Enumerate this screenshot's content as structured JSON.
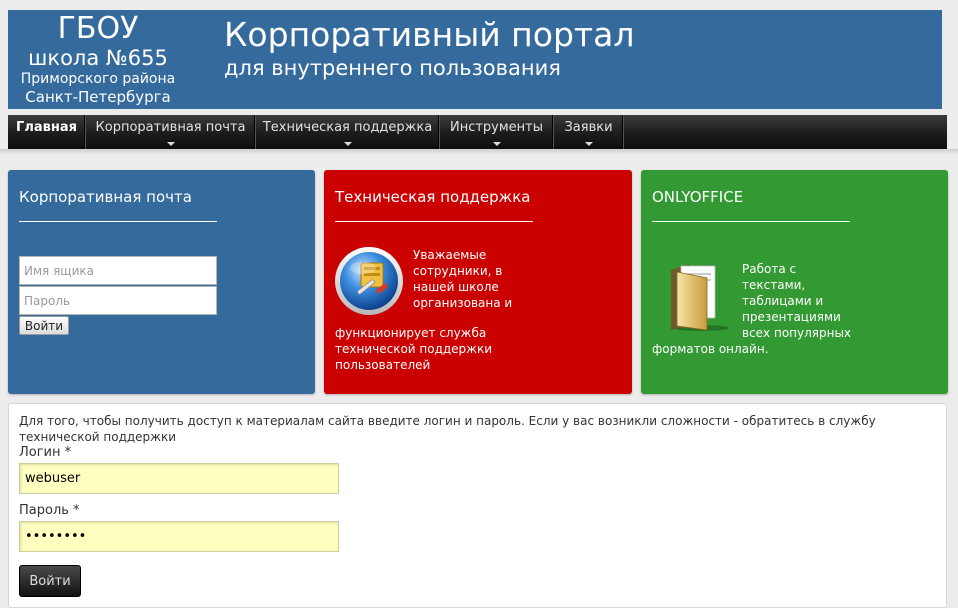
{
  "header": {
    "school_line1": "ГБОУ",
    "school_line2": "школа №655",
    "school_line3": "Приморского района",
    "school_line4": "Санкт-Петербурга",
    "portal_title": "Корпоративный портал",
    "portal_subtitle": "для внутреннего пользования"
  },
  "nav": {
    "items": [
      {
        "label": "Главная",
        "active": true,
        "dropdown": false
      },
      {
        "label": "Корпоративная почта",
        "active": false,
        "dropdown": true
      },
      {
        "label": "Техническая поддержка",
        "active": false,
        "dropdown": true
      },
      {
        "label": "Инструменты",
        "active": false,
        "dropdown": true
      },
      {
        "label": "Заявки",
        "active": false,
        "dropdown": true
      }
    ]
  },
  "tiles": {
    "mail": {
      "title": "Корпоративная почта",
      "mailbox_placeholder": "Имя ящика",
      "password_placeholder": "Пароль",
      "submit_label": "Войти",
      "color": "#356a9c"
    },
    "support": {
      "title": "Техническая поддержка",
      "text_part1": "Уважаемые сотрудники, в нашей школе организована и",
      "text_part2": "функционирует служба технической поддержки пользователей",
      "icon": "support-tools-icon",
      "color": "#cb0000"
    },
    "office": {
      "title": "ONLYOFFICE",
      "text_part1": "Работа с текстами, таблицами и презентациями всех популярных",
      "text_part2": "форматов онлайн.",
      "icon": "folder-documents-icon",
      "color": "#339933"
    }
  },
  "login_form": {
    "intro": "Для того, чтобы получить доступ к материалам сайта введите логин и пароль. Если у вас возникли сложности - обратитесь в службу технической поддержки",
    "login_label": "Логин *",
    "login_value": "webuser",
    "password_label": "Пароль *",
    "password_value": "password",
    "submit_label": "Войти"
  }
}
